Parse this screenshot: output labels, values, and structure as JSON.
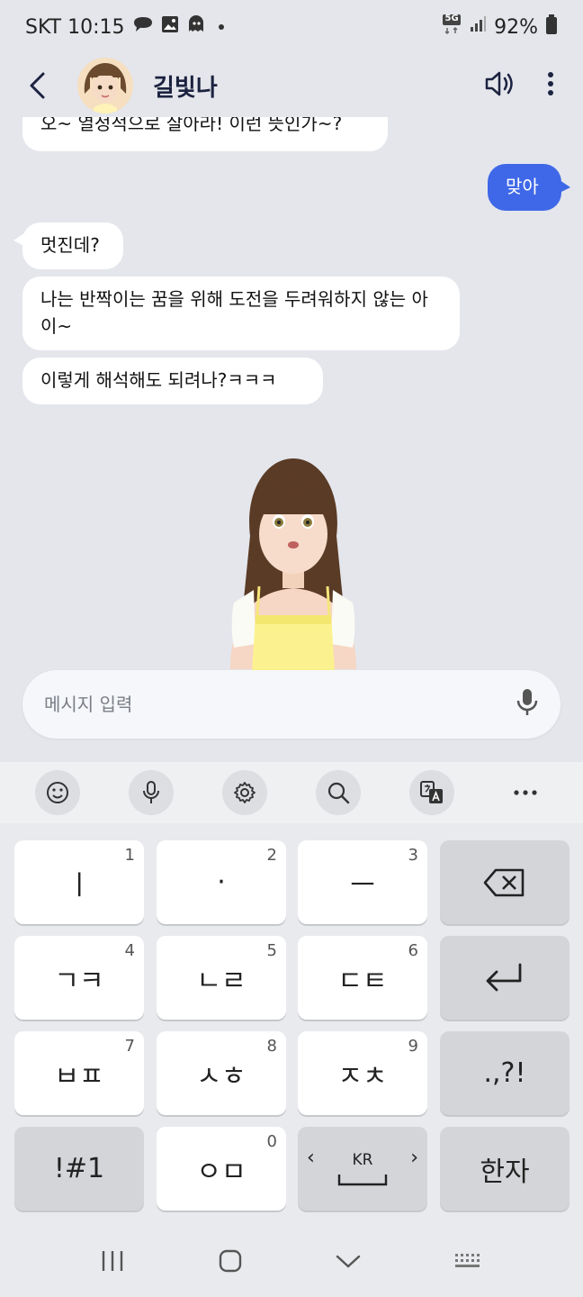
{
  "status_bar": {
    "carrier_time": "SKT 10:15",
    "network": "5G",
    "battery": "92%"
  },
  "header": {
    "contact_name": "길빛나"
  },
  "messages": [
    {
      "sender": "them",
      "text": "오~ 열정적으로 살아라! 이런 뜻인가~?"
    },
    {
      "sender": "me",
      "text": "맞아"
    },
    {
      "sender": "them",
      "text": "멋진데?"
    },
    {
      "sender": "them",
      "text": "나는 반짝이는 꿈을 위해 도전을 두려워하지 않는 아이~"
    },
    {
      "sender": "them",
      "text": "이렇게 해석해도 되려나?ㅋㅋㅋ"
    }
  ],
  "input": {
    "placeholder": "메시지 입력"
  },
  "keyboard": {
    "keys": [
      {
        "label": "ㅣ",
        "num": "1"
      },
      {
        "label": "·",
        "num": "2"
      },
      {
        "label": "ㅡ",
        "num": "3"
      },
      {
        "label": "ㄱㅋ",
        "num": "4"
      },
      {
        "label": "ㄴㄹ",
        "num": "5"
      },
      {
        "label": "ㄷㅌ",
        "num": "6"
      },
      {
        "label": "ㅂㅍ",
        "num": "7"
      },
      {
        "label": "ㅅㅎ",
        "num": "8"
      },
      {
        "label": "ㅈㅊ",
        "num": "9"
      },
      {
        "label": "ㅇㅁ",
        "num": "0"
      }
    ],
    "punct_label": ".,?!",
    "symbols_label": "!#1",
    "lang_label": "KR",
    "hanja_label": "한자"
  },
  "colors": {
    "accent": "#3f68e8",
    "background": "#e4e6ec"
  }
}
